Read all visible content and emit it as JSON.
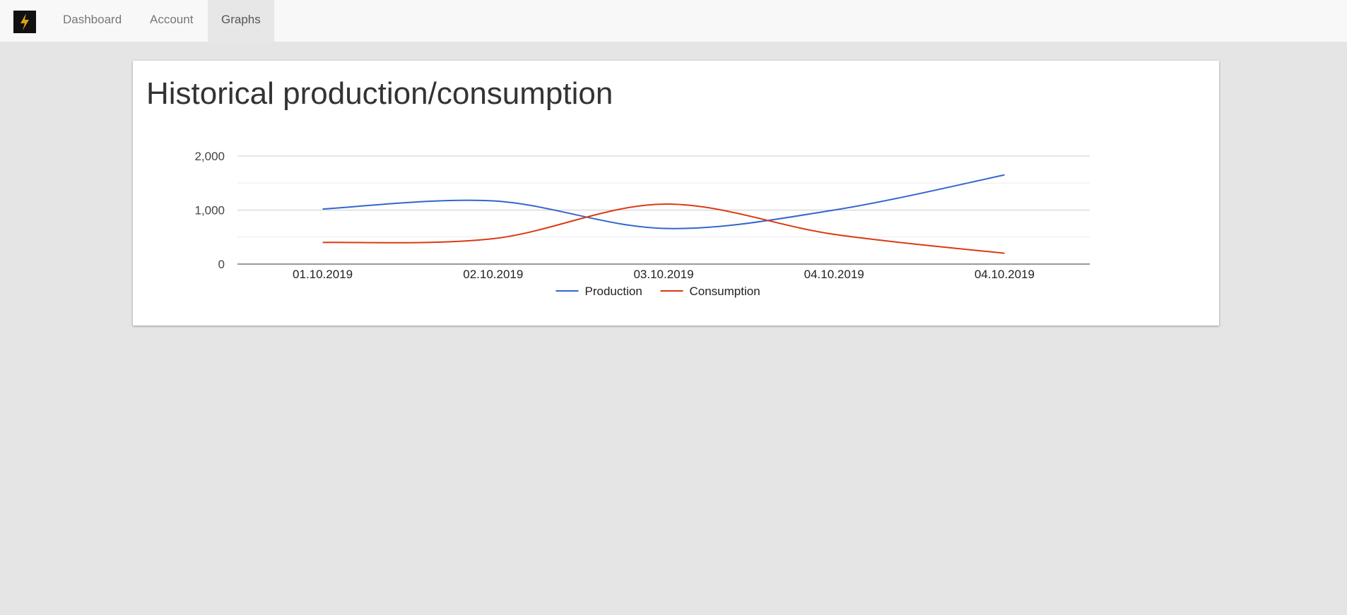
{
  "navbar": {
    "logo_icon": "lightning-bolt-icon",
    "items": [
      {
        "label": "Dashboard",
        "active": false
      },
      {
        "label": "Account",
        "active": false
      },
      {
        "label": "Graphs",
        "active": true
      }
    ]
  },
  "page": {
    "title": "Historical production/consumption"
  },
  "chart_data": {
    "type": "line",
    "categories": [
      "01.10.2019",
      "02.10.2019",
      "03.10.2019",
      "04.10.2019",
      "04.10.2019"
    ],
    "series": [
      {
        "name": "Production",
        "color": "#3366cc",
        "values": [
          1020,
          1170,
          660,
          1000,
          1650
        ]
      },
      {
        "name": "Consumption",
        "color": "#dc3912",
        "values": [
          400,
          470,
          1110,
          550,
          200
        ]
      }
    ],
    "yticks": [
      "0",
      "1,000",
      "2,000"
    ],
    "ylim": [
      0,
      2000
    ],
    "grid": true,
    "legend": "bottom"
  }
}
